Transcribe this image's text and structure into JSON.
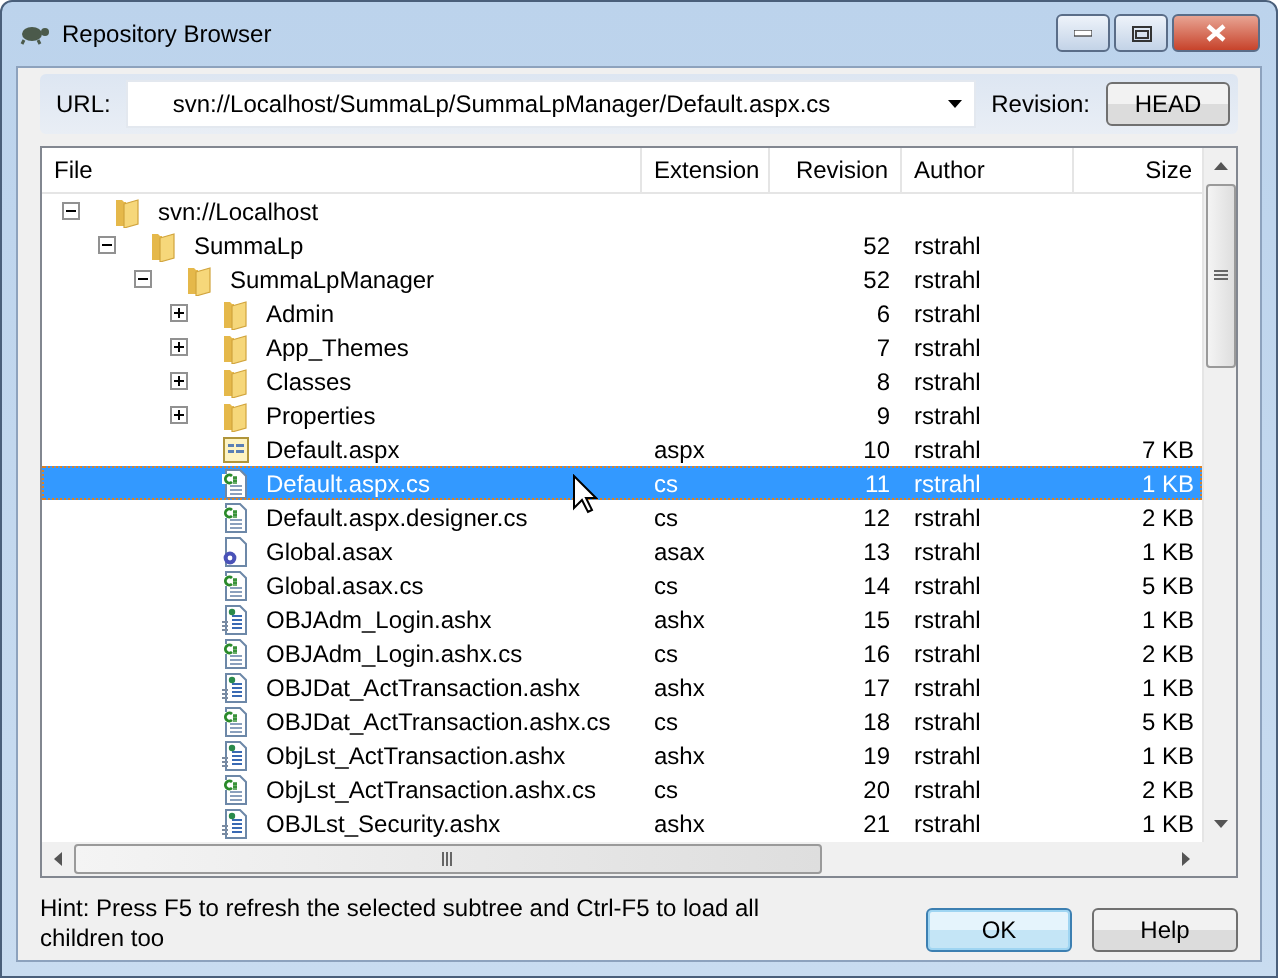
{
  "window": {
    "title": "Repository Browser"
  },
  "url_bar": {
    "label": "URL:",
    "value": "svn://Localhost/SummaLp/SummaLpManager/Default.aspx.cs",
    "revision_label": "Revision:",
    "revision_button": "HEAD"
  },
  "table": {
    "columns": [
      "File",
      "Extension",
      "Revision",
      "Author",
      "Size"
    ],
    "rows": [
      {
        "name": "svn://Localhost",
        "kind": "folder",
        "expanded": true,
        "selected": false,
        "children": [
          {
            "name": "SummaLp",
            "kind": "folder",
            "expanded": true,
            "selected": false,
            "revision": "52",
            "author": "rstrahl",
            "children": [
              {
                "name": "SummaLpManager",
                "kind": "folder",
                "expanded": true,
                "selected": false,
                "revision": "52",
                "author": "rstrahl",
                "children": [
                  {
                    "name": "Admin",
                    "kind": "folder",
                    "expanded": false,
                    "selected": false,
                    "revision": "6",
                    "author": "rstrahl"
                  },
                  {
                    "name": "App_Themes",
                    "kind": "folder",
                    "expanded": false,
                    "selected": false,
                    "revision": "7",
                    "author": "rstrahl"
                  },
                  {
                    "name": "Classes",
                    "kind": "folder",
                    "expanded": false,
                    "selected": false,
                    "revision": "8",
                    "author": "rstrahl"
                  },
                  {
                    "name": "Properties",
                    "kind": "folder",
                    "expanded": false,
                    "selected": false,
                    "revision": "9",
                    "author": "rstrahl"
                  },
                  {
                    "name": "Default.aspx",
                    "kind": "page",
                    "selected": false,
                    "extension": "aspx",
                    "revision": "10",
                    "author": "rstrahl",
                    "size": "7 KB"
                  },
                  {
                    "name": "Default.aspx.cs",
                    "kind": "csharp",
                    "selected": true,
                    "extension": "cs",
                    "revision": "11",
                    "author": "rstrahl",
                    "size": "1 KB"
                  },
                  {
                    "name": "Default.aspx.designer.cs",
                    "kind": "csharp",
                    "selected": false,
                    "extension": "cs",
                    "revision": "12",
                    "author": "rstrahl",
                    "size": "2 KB"
                  },
                  {
                    "name": "Global.asax",
                    "kind": "config",
                    "selected": false,
                    "extension": "asax",
                    "revision": "13",
                    "author": "rstrahl",
                    "size": "1 KB"
                  },
                  {
                    "name": "Global.asax.cs",
                    "kind": "csharp",
                    "selected": false,
                    "extension": "cs",
                    "revision": "14",
                    "author": "rstrahl",
                    "size": "5 KB"
                  },
                  {
                    "name": "OBJAdm_Login.ashx",
                    "kind": "handler",
                    "selected": false,
                    "extension": "ashx",
                    "revision": "15",
                    "author": "rstrahl",
                    "size": "1 KB"
                  },
                  {
                    "name": "OBJAdm_Login.ashx.cs",
                    "kind": "csharp",
                    "selected": false,
                    "extension": "cs",
                    "revision": "16",
                    "author": "rstrahl",
                    "size": "2 KB"
                  },
                  {
                    "name": "OBJDat_ActTransaction.ashx",
                    "kind": "handler",
                    "selected": false,
                    "extension": "ashx",
                    "revision": "17",
                    "author": "rstrahl",
                    "size": "1 KB"
                  },
                  {
                    "name": "OBJDat_ActTransaction.ashx.cs",
                    "kind": "csharp",
                    "selected": false,
                    "extension": "cs",
                    "revision": "18",
                    "author": "rstrahl",
                    "size": "5 KB"
                  },
                  {
                    "name": "ObjLst_ActTransaction.ashx",
                    "kind": "handler",
                    "selected": false,
                    "extension": "ashx",
                    "revision": "19",
                    "author": "rstrahl",
                    "size": "1 KB"
                  },
                  {
                    "name": "ObjLst_ActTransaction.ashx.cs",
                    "kind": "csharp",
                    "selected": false,
                    "extension": "cs",
                    "revision": "20",
                    "author": "rstrahl",
                    "size": "2 KB"
                  },
                  {
                    "name": "OBJLst_Security.ashx",
                    "kind": "handler",
                    "selected": false,
                    "extension": "ashx",
                    "revision": "21",
                    "author": "rstrahl",
                    "size": "1 KB"
                  }
                ]
              }
            ]
          }
        ]
      }
    ]
  },
  "hint": "Hint: Press F5 to refresh the selected subtree and Ctrl-F5 to load all children too",
  "buttons": [
    {
      "label": "OK",
      "default": true
    },
    {
      "label": "Help",
      "default": false
    }
  ]
}
